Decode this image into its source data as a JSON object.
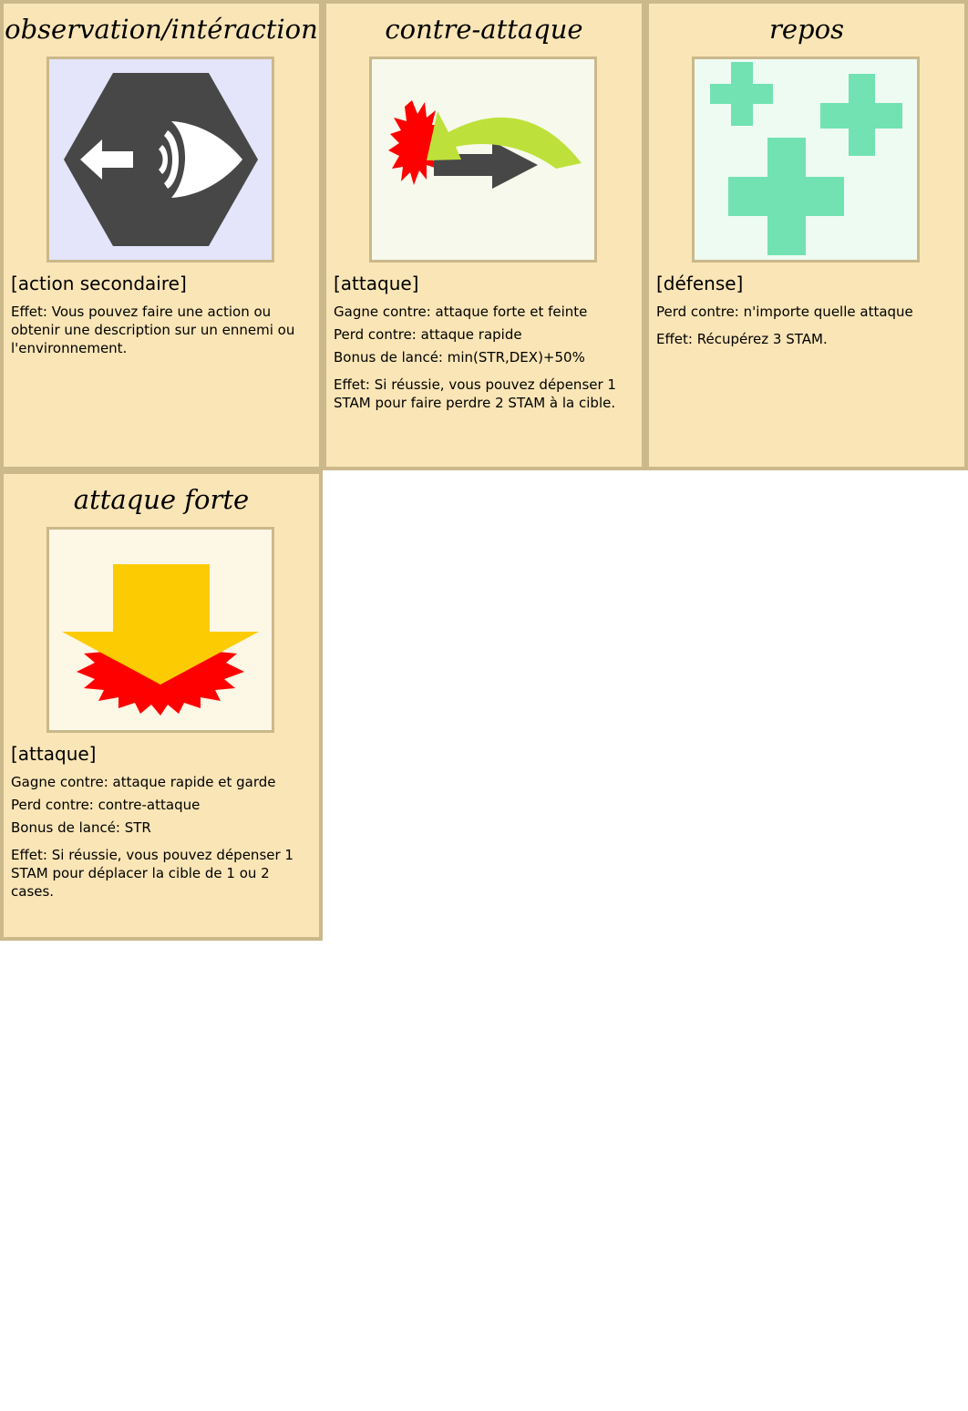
{
  "cards": [
    {
      "title": "observation/intéraction",
      "art_icon": "eye-hexagon-icon",
      "art_background": "#e4e4fb",
      "category": "[action secondaire]",
      "stats": [],
      "effect": "Effet: Vous pouvez faire une action ou obtenir une description sur un ennemi ou l'environnement."
    },
    {
      "title": "contre-attaque",
      "art_icon": "counter-attack-icon",
      "art_background": "#f6f9eb",
      "category": "[attaque]",
      "stats": [
        "Gagne contre: attaque forte et feinte",
        "Perd contre: attaque rapide",
        "Bonus de lancé: min(STR,DEX)+50%"
      ],
      "effect": "Effet: Si réussie, vous pouvez dépenser 1 STAM pour faire perdre 2 STAM à la cible."
    },
    {
      "title": "repos",
      "art_icon": "healing-crosses-icon",
      "art_background": "#eefbf3",
      "category": "[défense]",
      "stats": [
        "Perd contre: n'importe quelle attaque"
      ],
      "effect": "Effet: Récupérez 3 STAM."
    },
    {
      "title": "attaque forte",
      "art_icon": "heavy-strike-icon",
      "art_background": "#fdf7e6",
      "category": "[attaque]",
      "stats": [
        "Gagne contre: attaque rapide et garde",
        "Perd contre: contre-attaque",
        "Bonus de lancé: STR"
      ],
      "effect": "Effet: Si réussie, vous pouvez dépenser 1 STAM pour déplacer la cible de 1 ou 2 cases."
    }
  ],
  "colors": {
    "card_background": "#f9e5b6",
    "card_border": "#cbb88b",
    "eye_hexagon": "#474747",
    "counter_arrow_green": "#bde13a",
    "impact_red": "#ff0000",
    "heal_green": "#72e2b2",
    "strike_yellow": "#fccb02"
  }
}
